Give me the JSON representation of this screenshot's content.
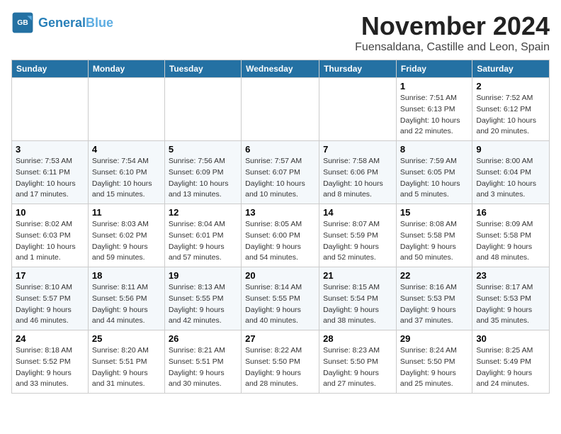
{
  "header": {
    "logo_general": "General",
    "logo_blue": "Blue",
    "month": "November 2024",
    "location": "Fuensaldana, Castille and Leon, Spain"
  },
  "weekdays": [
    "Sunday",
    "Monday",
    "Tuesday",
    "Wednesday",
    "Thursday",
    "Friday",
    "Saturday"
  ],
  "weeks": [
    [
      {
        "day": "",
        "info": ""
      },
      {
        "day": "",
        "info": ""
      },
      {
        "day": "",
        "info": ""
      },
      {
        "day": "",
        "info": ""
      },
      {
        "day": "",
        "info": ""
      },
      {
        "day": "1",
        "info": "Sunrise: 7:51 AM\nSunset: 6:13 PM\nDaylight: 10 hours and 22 minutes."
      },
      {
        "day": "2",
        "info": "Sunrise: 7:52 AM\nSunset: 6:12 PM\nDaylight: 10 hours and 20 minutes."
      }
    ],
    [
      {
        "day": "3",
        "info": "Sunrise: 7:53 AM\nSunset: 6:11 PM\nDaylight: 10 hours and 17 minutes."
      },
      {
        "day": "4",
        "info": "Sunrise: 7:54 AM\nSunset: 6:10 PM\nDaylight: 10 hours and 15 minutes."
      },
      {
        "day": "5",
        "info": "Sunrise: 7:56 AM\nSunset: 6:09 PM\nDaylight: 10 hours and 13 minutes."
      },
      {
        "day": "6",
        "info": "Sunrise: 7:57 AM\nSunset: 6:07 PM\nDaylight: 10 hours and 10 minutes."
      },
      {
        "day": "7",
        "info": "Sunrise: 7:58 AM\nSunset: 6:06 PM\nDaylight: 10 hours and 8 minutes."
      },
      {
        "day": "8",
        "info": "Sunrise: 7:59 AM\nSunset: 6:05 PM\nDaylight: 10 hours and 5 minutes."
      },
      {
        "day": "9",
        "info": "Sunrise: 8:00 AM\nSunset: 6:04 PM\nDaylight: 10 hours and 3 minutes."
      }
    ],
    [
      {
        "day": "10",
        "info": "Sunrise: 8:02 AM\nSunset: 6:03 PM\nDaylight: 10 hours and 1 minute."
      },
      {
        "day": "11",
        "info": "Sunrise: 8:03 AM\nSunset: 6:02 PM\nDaylight: 9 hours and 59 minutes."
      },
      {
        "day": "12",
        "info": "Sunrise: 8:04 AM\nSunset: 6:01 PM\nDaylight: 9 hours and 57 minutes."
      },
      {
        "day": "13",
        "info": "Sunrise: 8:05 AM\nSunset: 6:00 PM\nDaylight: 9 hours and 54 minutes."
      },
      {
        "day": "14",
        "info": "Sunrise: 8:07 AM\nSunset: 5:59 PM\nDaylight: 9 hours and 52 minutes."
      },
      {
        "day": "15",
        "info": "Sunrise: 8:08 AM\nSunset: 5:58 PM\nDaylight: 9 hours and 50 minutes."
      },
      {
        "day": "16",
        "info": "Sunrise: 8:09 AM\nSunset: 5:58 PM\nDaylight: 9 hours and 48 minutes."
      }
    ],
    [
      {
        "day": "17",
        "info": "Sunrise: 8:10 AM\nSunset: 5:57 PM\nDaylight: 9 hours and 46 minutes."
      },
      {
        "day": "18",
        "info": "Sunrise: 8:11 AM\nSunset: 5:56 PM\nDaylight: 9 hours and 44 minutes."
      },
      {
        "day": "19",
        "info": "Sunrise: 8:13 AM\nSunset: 5:55 PM\nDaylight: 9 hours and 42 minutes."
      },
      {
        "day": "20",
        "info": "Sunrise: 8:14 AM\nSunset: 5:55 PM\nDaylight: 9 hours and 40 minutes."
      },
      {
        "day": "21",
        "info": "Sunrise: 8:15 AM\nSunset: 5:54 PM\nDaylight: 9 hours and 38 minutes."
      },
      {
        "day": "22",
        "info": "Sunrise: 8:16 AM\nSunset: 5:53 PM\nDaylight: 9 hours and 37 minutes."
      },
      {
        "day": "23",
        "info": "Sunrise: 8:17 AM\nSunset: 5:53 PM\nDaylight: 9 hours and 35 minutes."
      }
    ],
    [
      {
        "day": "24",
        "info": "Sunrise: 8:18 AM\nSunset: 5:52 PM\nDaylight: 9 hours and 33 minutes."
      },
      {
        "day": "25",
        "info": "Sunrise: 8:20 AM\nSunset: 5:51 PM\nDaylight: 9 hours and 31 minutes."
      },
      {
        "day": "26",
        "info": "Sunrise: 8:21 AM\nSunset: 5:51 PM\nDaylight: 9 hours and 30 minutes."
      },
      {
        "day": "27",
        "info": "Sunrise: 8:22 AM\nSunset: 5:50 PM\nDaylight: 9 hours and 28 minutes."
      },
      {
        "day": "28",
        "info": "Sunrise: 8:23 AM\nSunset: 5:50 PM\nDaylight: 9 hours and 27 minutes."
      },
      {
        "day": "29",
        "info": "Sunrise: 8:24 AM\nSunset: 5:50 PM\nDaylight: 9 hours and 25 minutes."
      },
      {
        "day": "30",
        "info": "Sunrise: 8:25 AM\nSunset: 5:49 PM\nDaylight: 9 hours and 24 minutes."
      }
    ]
  ]
}
